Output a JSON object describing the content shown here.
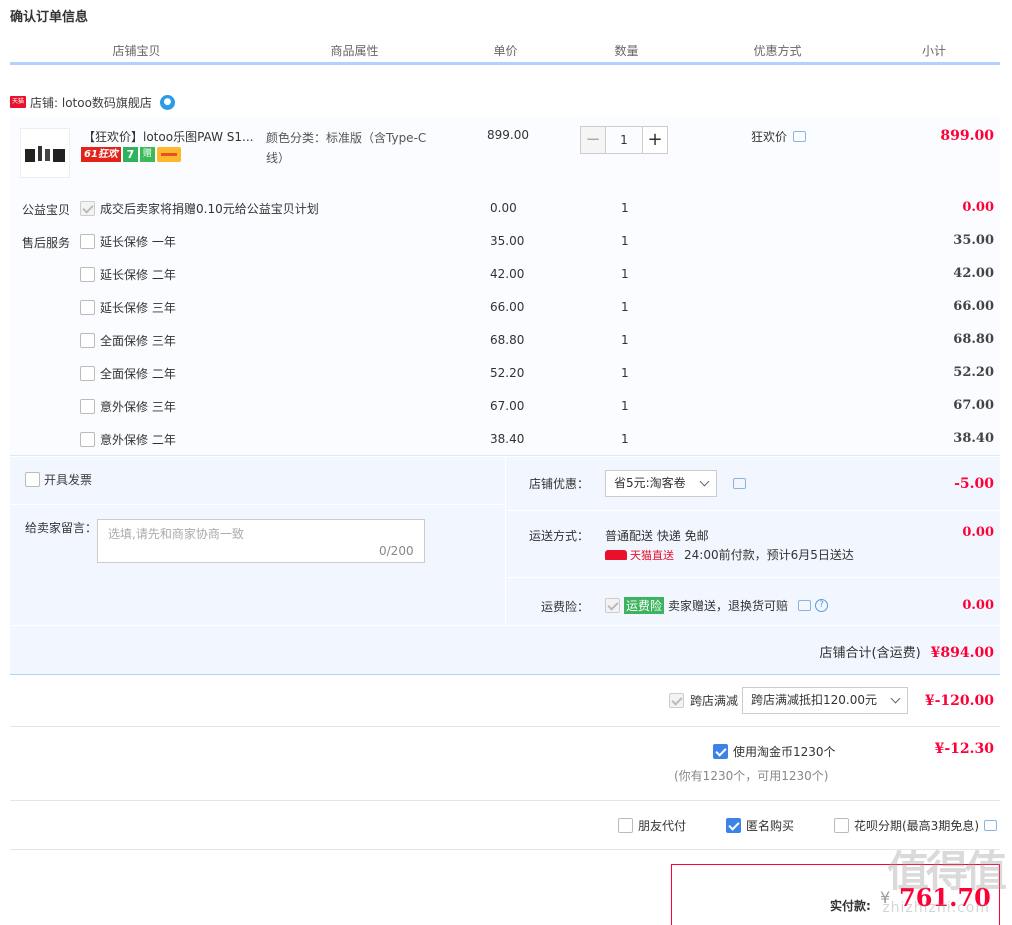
{
  "page_title": "确认订单信息",
  "columns": [
    "店铺宝贝",
    "商品属性",
    "单价",
    "数量",
    "优惠方式",
    "小计"
  ],
  "shop": {
    "badge": "天猫",
    "label": "店铺: lotoo数码旗舰店",
    "chat_icon": "wangwang-icon"
  },
  "product": {
    "name": "【狂欢价】lotoo乐图PAW S1...",
    "promo_61": "61狂欢",
    "promo_7": "7",
    "promo_gift": "赠",
    "attr": "颜色分类：标准版（含Type-C线）",
    "price": "899.00",
    "qty": "1",
    "qty_minus": "−",
    "qty_plus": "+",
    "discount": "狂欢价",
    "subtotal": "899.00"
  },
  "charity": {
    "label": "公益宝贝",
    "text": "成交后卖家将捐赠0.10元给公益宝贝计划",
    "price": "0.00",
    "qty": "1",
    "subtotal": "0.00"
  },
  "aftersale_label": "售后服务",
  "services": [
    {
      "name": "延长保修 一年",
      "price": "35.00",
      "qty": "1",
      "subtotal": "35.00"
    },
    {
      "name": "延长保修 二年",
      "price": "42.00",
      "qty": "1",
      "subtotal": "42.00"
    },
    {
      "name": "延长保修 三年",
      "price": "66.00",
      "qty": "1",
      "subtotal": "66.00"
    },
    {
      "name": "全面保修 三年",
      "price": "68.80",
      "qty": "1",
      "subtotal": "68.80"
    },
    {
      "name": "全面保修 二年",
      "price": "52.20",
      "qty": "1",
      "subtotal": "52.20"
    },
    {
      "name": "意外保修 三年",
      "price": "67.00",
      "qty": "1",
      "subtotal": "67.00"
    },
    {
      "name": "意外保修 二年",
      "price": "38.40",
      "qty": "1",
      "subtotal": "38.40"
    }
  ],
  "invoice": {
    "label": "开具发票"
  },
  "message": {
    "label": "给卖家留言：",
    "placeholder": "选填,请先和商家协商一致",
    "count": "0/200"
  },
  "shop_discount": {
    "label": "店铺优惠：",
    "selected": "省5元:淘客卷",
    "amount": "-5.00"
  },
  "shipping": {
    "label": "运送方式：",
    "method": "普通配送 快递 免邮",
    "badge": "天猫直送",
    "eta": "24:00前付款，预计6月5日送达",
    "amount": "0.00"
  },
  "insurance": {
    "label": "运费险：",
    "badge": "运费险",
    "text": "卖家赠送，退换货可赔",
    "amount": "0.00"
  },
  "shop_total": {
    "label": "店铺合计(含运费)",
    "amount": "¥894.00"
  },
  "cross_store": {
    "label": "跨店满减",
    "selected": "跨店满减抵扣120.00元",
    "amount": "¥-120.00"
  },
  "coins": {
    "label": "使用淘金币1230个",
    "note": "(你有1230个，可用1230个)",
    "amount": "¥-12.30"
  },
  "options": {
    "friend_pay": "朋友代付",
    "anonymous": "匿名购买",
    "huabei": "花呗分期(最高3期免息)"
  },
  "payment": {
    "label": "实付款:",
    "currency": "¥",
    "amount": "761.70"
  },
  "watermark": {
    "main": "值得值",
    "sub": "zhizhizhi.com"
  }
}
